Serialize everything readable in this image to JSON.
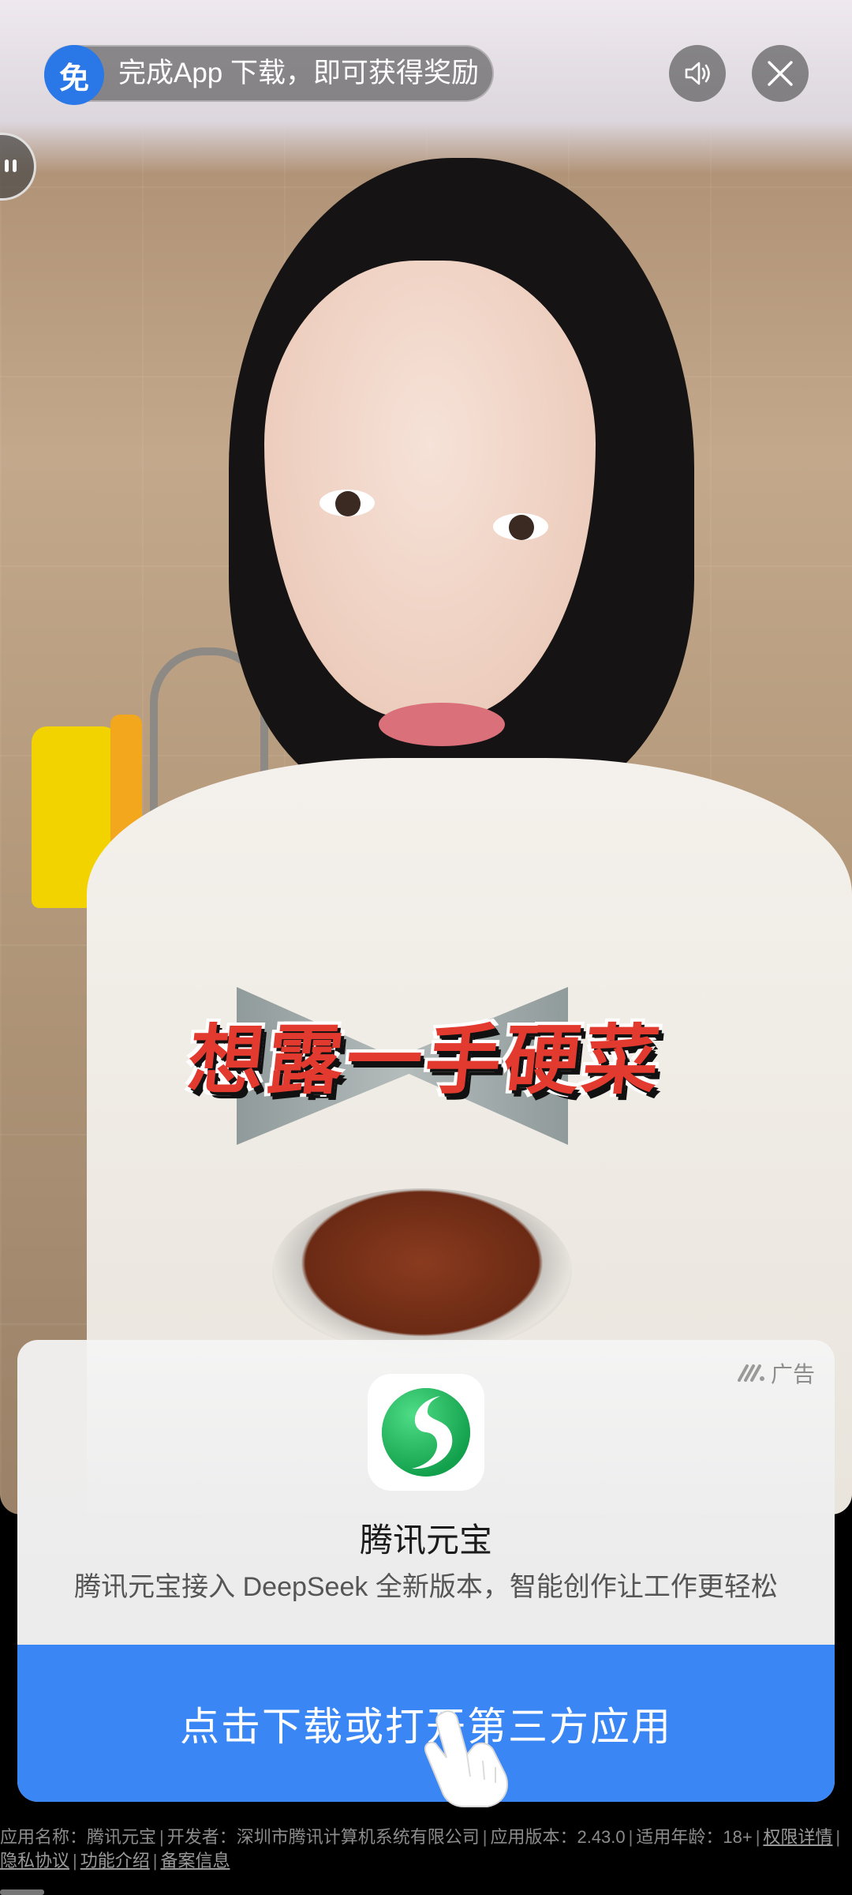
{
  "overlay": {
    "badge": "免",
    "reward_text": "完成App 下载，即可获得奖励"
  },
  "video": {
    "caption": "想露一手硬菜"
  },
  "ad_card": {
    "ad_label": "广告",
    "app_name": "腾讯元宝",
    "app_description": "腾讯元宝接入 DeepSeek 全新版本，智能创作让工作更轻松",
    "cta_label": "点击下载或打开第三方应用"
  },
  "footer": {
    "app_name_label": "应用名称：腾讯元宝",
    "developer_label": "开发者：深圳市腾讯计算机系统有限公司",
    "version_label": "应用版本：2.43.0",
    "age_label": "适用年龄：18+",
    "permissions_link": "权限详情",
    "privacy_link": "隐私协议",
    "features_link": "功能介绍",
    "filing_link": "备案信息"
  },
  "icons": {
    "sound": "speaker-icon",
    "close": "close-icon",
    "ad_logo": "ad-logo-icon",
    "app": "yuanbao-app-icon",
    "hand": "tap-hand-icon"
  },
  "colors": {
    "accent_blue": "#3b86f5",
    "badge_blue": "#2a77e8",
    "caption_red": "#e23a2f"
  }
}
